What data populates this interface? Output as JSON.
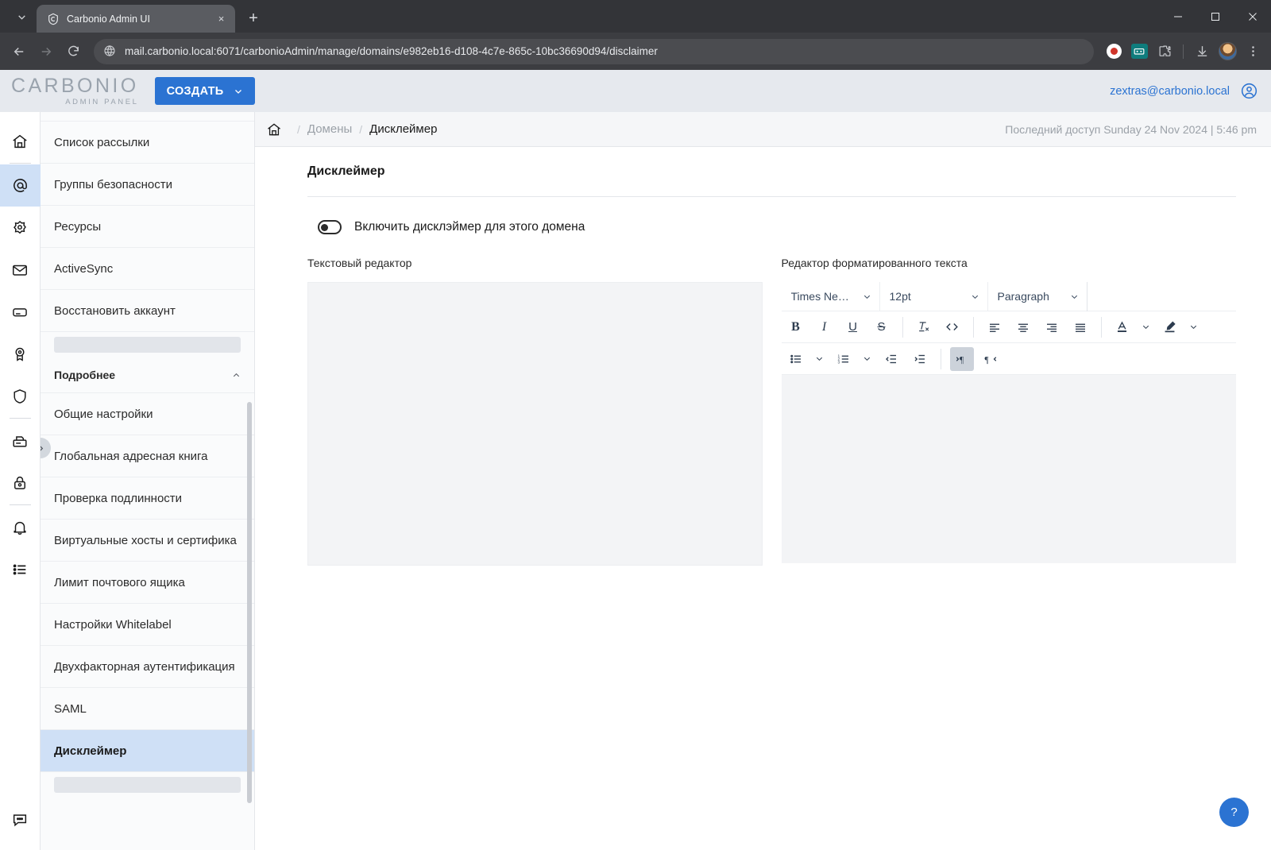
{
  "browser": {
    "tab": {
      "title": "Carbonio Admin UI",
      "favicon": "carbonio-c-icon",
      "close": "×"
    },
    "new_tab_label": "+",
    "tab_list_icon": "chevron-down-icon",
    "url": "mail.carbonio.local:6071/carbonioAdmin/manage/domains/e982eb16-d108-4c7e-865c-10bc36690d94/disclaimer",
    "nav": {
      "back": "back-arrow-icon",
      "forward": "forward-arrow-icon",
      "reload": "reload-icon"
    },
    "site_icon": "globe-icon",
    "toolbar_icons": [
      "record-icon",
      "extension-teal-icon",
      "extensions-puzzle-icon",
      "download-icon",
      "profile-avatar",
      "browser-menu-icon"
    ],
    "window_controls": {
      "minimize": "—",
      "maximize": "▢",
      "close": "✕"
    }
  },
  "header": {
    "logo_main": "CARBONIO",
    "logo_sub": "ADMIN PANEL",
    "create_button": "СОЗДАТЬ",
    "create_chevron": "chevron-down-icon",
    "user_email": "zextras@carbonio.local",
    "user_icon": "account-circle-icon"
  },
  "breadcrumb": {
    "home_icon": "home-icon",
    "separator": "/",
    "parent": "Домены",
    "current": "Дисклеймер",
    "last_access": "Последний доступ Sunday 24 Nov 2024 | 5:46 pm"
  },
  "rail": {
    "items": [
      {
        "icon": "home-icon",
        "active": false
      },
      {
        "icon": "at-mail-icon",
        "active": true
      },
      {
        "icon": "gear-flower-icon",
        "active": false
      },
      {
        "icon": "mail-folder-icon",
        "active": false
      },
      {
        "icon": "storage-drive-icon",
        "active": false
      },
      {
        "icon": "award-badge-icon",
        "active": false
      },
      {
        "icon": "shield-icon",
        "active": false
      },
      {
        "icon": "fax-printer-icon",
        "active": false
      },
      {
        "icon": "lock-icon",
        "active": false
      },
      {
        "icon": "bell-icon",
        "active": false
      },
      {
        "icon": "list-icon",
        "active": false
      }
    ],
    "bottom_icon": "chat-bubble-icon",
    "collapse_icon": "chevron-right-icon"
  },
  "sidebar": {
    "items": [
      {
        "label": "Список рассылки",
        "selected": false
      },
      {
        "label": "Группы безопасности",
        "selected": false
      },
      {
        "label": "Ресурсы",
        "selected": false
      },
      {
        "label": "ActiveSync",
        "selected": false
      },
      {
        "label": "Восстановить аккаунт",
        "selected": false
      }
    ],
    "section": {
      "label": "Подробнее",
      "chevron": "chevron-up-icon"
    },
    "more_items": [
      {
        "label": "Общие настройки",
        "selected": false
      },
      {
        "label": "Глобальная адресная книга",
        "selected": false
      },
      {
        "label": "Проверка подлинности",
        "selected": false
      },
      {
        "label": "Виртуальные хосты и сертифика",
        "selected": false
      },
      {
        "label": "Лимит почтового ящика",
        "selected": false
      },
      {
        "label": "Настройки Whitelabel",
        "selected": false
      },
      {
        "label": "Двухфакторная аутентификация",
        "selected": false
      },
      {
        "label": "SAML",
        "selected": false
      },
      {
        "label": "Дисклеймер",
        "selected": true
      }
    ]
  },
  "page": {
    "title": "Дисклеймер",
    "toggle": {
      "label": "Включить дисклэймер для этого домена",
      "enabled": false
    },
    "plain_editor": {
      "label": "Текстовый редактор",
      "value": ""
    },
    "rich_editor": {
      "label": "Редактор форматированного текста",
      "value": "",
      "font_family": "Times New R...",
      "font_size": "12pt",
      "block_format": "Paragraph",
      "chevron": "chevron-down-icon",
      "tools_row1": [
        {
          "name": "bold-icon",
          "glyph": "B"
        },
        {
          "name": "italic-icon",
          "glyph": "I"
        },
        {
          "name": "underline-icon",
          "glyph": "U"
        },
        {
          "name": "strikethrough-icon",
          "glyph": "S"
        },
        {
          "name": "clear-formatting-icon",
          "glyph": "Tx"
        },
        {
          "name": "source-code-icon",
          "glyph": "<>"
        },
        {
          "name": "align-left-icon",
          "glyph": ""
        },
        {
          "name": "align-center-icon",
          "glyph": ""
        },
        {
          "name": "align-right-icon",
          "glyph": ""
        },
        {
          "name": "align-justify-icon",
          "glyph": ""
        },
        {
          "name": "text-color-icon",
          "glyph": "A"
        },
        {
          "name": "highlight-color-icon",
          "glyph": ""
        }
      ],
      "tools_row2": [
        {
          "name": "bullet-list-icon"
        },
        {
          "name": "numbered-list-icon"
        },
        {
          "name": "outdent-icon"
        },
        {
          "name": "indent-icon"
        },
        {
          "name": "ltr-direction-icon",
          "active": true
        },
        {
          "name": "rtl-direction-icon",
          "active": false
        }
      ]
    },
    "help_button": "?"
  },
  "colors": {
    "accent": "#2b73d2",
    "selected_row": "#cfe0f6",
    "header_bg": "#e6e9ee",
    "editor_bg": "#f3f4f6"
  }
}
